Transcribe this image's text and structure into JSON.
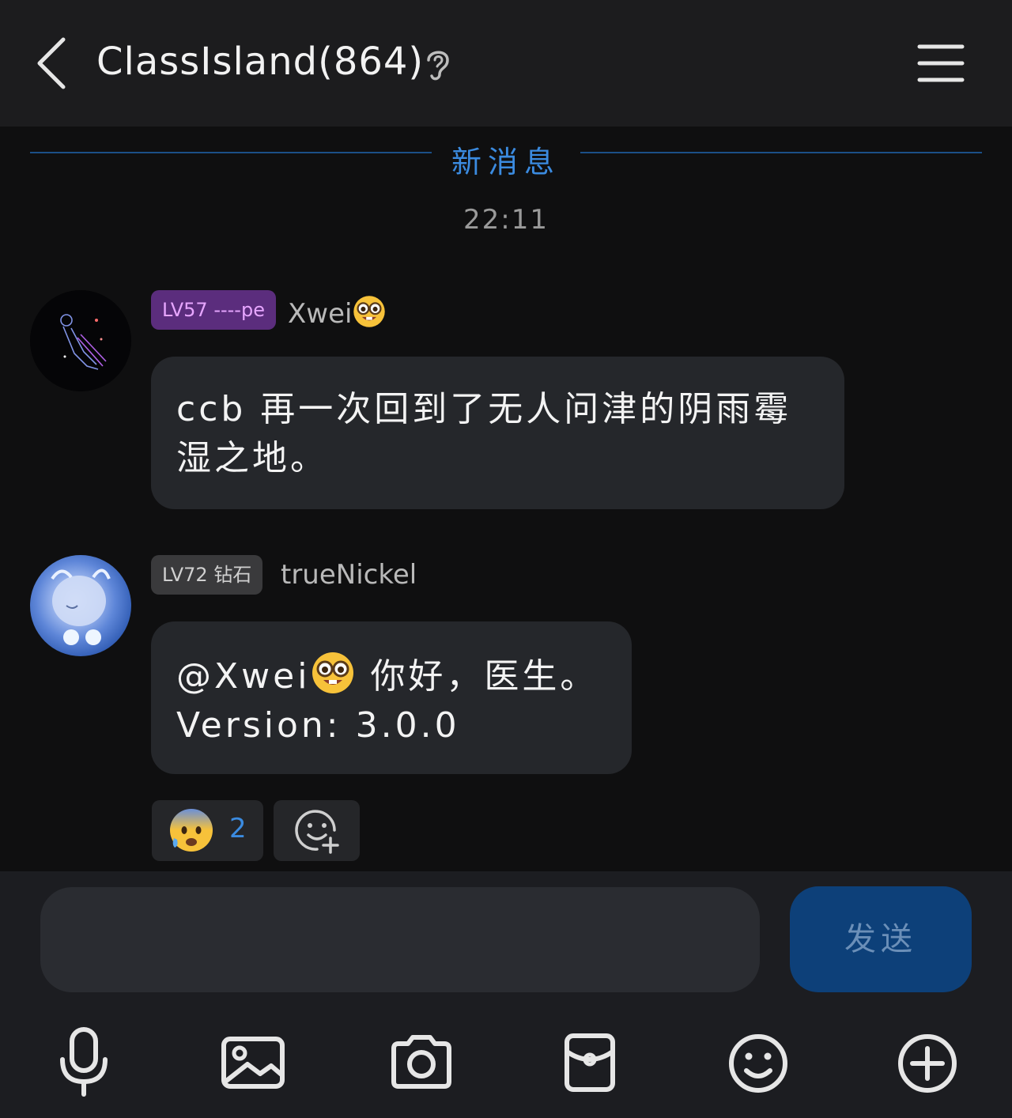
{
  "header": {
    "title": "ClassIsland(864)",
    "back_icon": "chevron-left-icon",
    "ear_icon": "ear-icon",
    "menu_icon": "hamburger-menu-icon"
  },
  "divider": {
    "label": "新消息"
  },
  "timestamp": "22:11",
  "messages": [
    {
      "badge": "LV57 ----pe",
      "nickname": "Xwei",
      "nickname_emoji": "nerd-face-emoji",
      "text": "ccb 再一次回到了无人问津的阴雨霉湿之地。"
    },
    {
      "badge": "LV72 钻石",
      "nickname": "trueNickel",
      "mention": "@Xwei",
      "mention_emoji": "nerd-face-emoji",
      "text_line1": "你好，医生。",
      "text_line2": "Version: 3.0.0"
    }
  ],
  "reactions": [
    {
      "emoji": "anxious-face-with-sweat-emoji",
      "count": "2"
    },
    {
      "emoji": "add-reaction-icon"
    }
  ],
  "input": {
    "placeholder": "",
    "value": ""
  },
  "send_label": "发送",
  "toolbar": [
    "microphone-icon",
    "image-icon",
    "camera-icon",
    "red-packet-icon",
    "emoji-icon",
    "plus-icon"
  ],
  "colors": {
    "accent": "#3b8be0",
    "send_button": "#0d4079",
    "badge_purple": "#5b2d7d"
  }
}
